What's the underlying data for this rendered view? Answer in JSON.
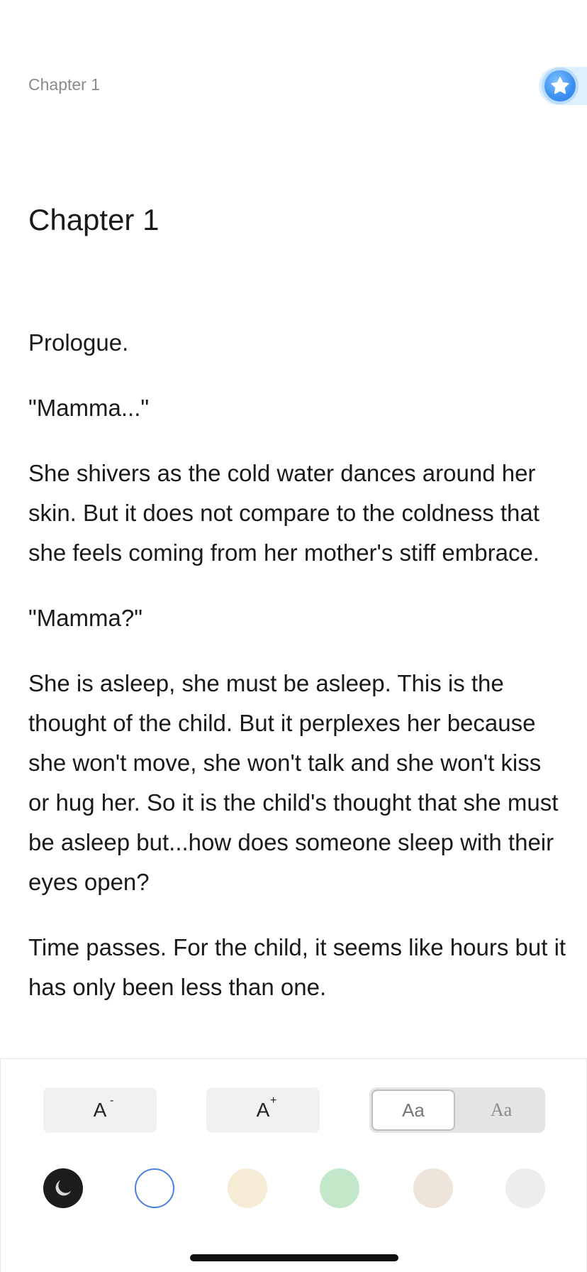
{
  "header": {
    "chapter_label": "Chapter 1"
  },
  "badge": {
    "icon": "star-badge-icon",
    "color": "#3c8ff0"
  },
  "chapter_title": "Chapter 1",
  "paragraphs": [
    "Prologue.",
    "\"Mamma...\"",
    "She shivers as the cold water dances around her skin. But it does not compare to the coldness that she feels coming from her mother's stiff embrace.",
    "\"Mamma?\"",
    "She is asleep, she must be asleep. This is the thought of the child. But it perplexes her because she won't move, she won't talk and she won't kiss or hug her. So it is the child's thought that she must be asleep but...how does someone sleep with their eyes open?",
    "Time passes. For the child, it seems like hours but it has only been less than one."
  ],
  "settings": {
    "font_decrease": {
      "glyph": "A",
      "modifier": "-"
    },
    "font_increase": {
      "glyph": "A",
      "modifier": "+"
    },
    "font_styles": [
      {
        "label": "Aa",
        "selected": true
      },
      {
        "label": "Aa",
        "selected": false
      }
    ],
    "themes": [
      {
        "name": "night",
        "color": "#1c1c1e",
        "icon": "moon-icon"
      },
      {
        "name": "white",
        "color": "#ffffff",
        "selected": true
      },
      {
        "name": "cream",
        "color": "#f6ecd6"
      },
      {
        "name": "green",
        "color": "#c3e8c9"
      },
      {
        "name": "tan",
        "color": "#eee4d9"
      },
      {
        "name": "gray",
        "color": "#ededef"
      }
    ]
  }
}
